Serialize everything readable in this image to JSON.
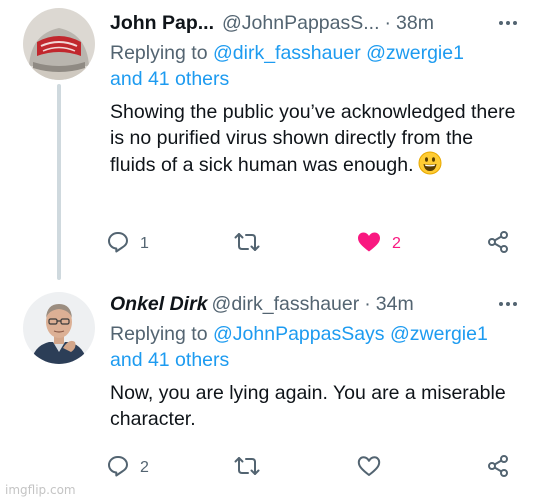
{
  "tweets": [
    {
      "name": "John Pap...",
      "handle": "@JohnPappasS...",
      "separator": "·",
      "time": "38m",
      "replying_prefix": "Replying to ",
      "mentions": [
        "@dirk_fasshauer",
        "@zwergie1"
      ],
      "others": "and 41 others",
      "text": "Showing the public you’ve acknowledged there is no purified virus shown directly from the fluids of a sick human was enough.",
      "emoji": "smiley-emoji",
      "reply_count": "1",
      "retweet_count": "",
      "like_count": "2",
      "liked": true
    },
    {
      "name": "Onkel Dirk",
      "handle": "@dirk_fasshauer",
      "separator": "·",
      "time": "34m",
      "replying_prefix": "Replying to ",
      "mentions": [
        "@JohnPappasSays",
        "@zwergie1"
      ],
      "others": "and 41 others",
      "text": "Now, you are lying again. You are a miserable character.",
      "reply_count": "2",
      "retweet_count": "",
      "like_count": "",
      "liked": false
    }
  ],
  "colors": {
    "text": "#0f1419",
    "secondary": "#536471",
    "link": "#1d9bf0",
    "like": "#f91880",
    "thread_line": "#cfd9de"
  },
  "icons": [
    "more-icon",
    "reply-icon",
    "retweet-icon",
    "like-icon",
    "share-icon"
  ],
  "watermark": "imgflip.com"
}
